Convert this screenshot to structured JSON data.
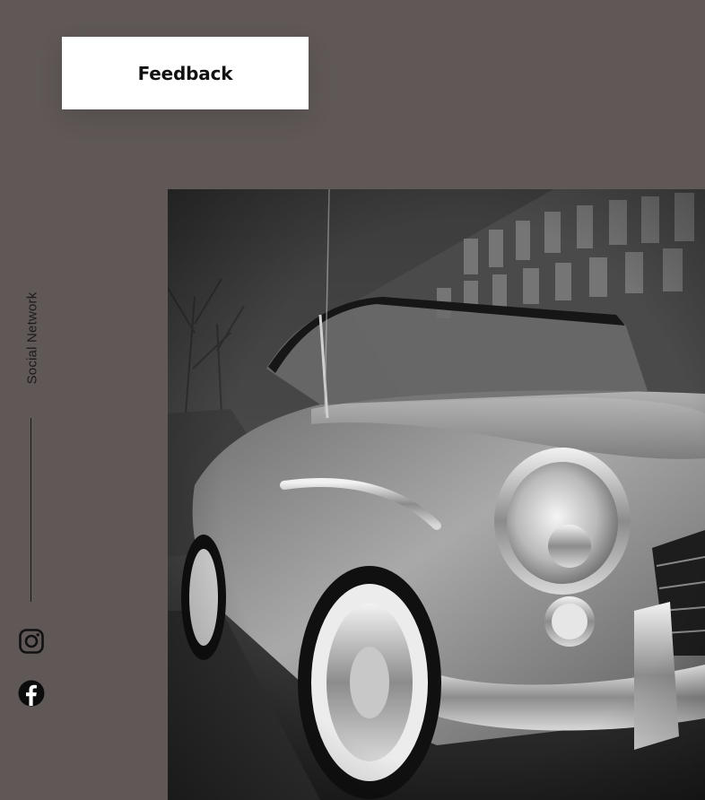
{
  "feedback": {
    "label": "Feedback"
  },
  "social": {
    "label": "Social Network",
    "icons": [
      "instagram-icon",
      "facebook-icon"
    ]
  },
  "colors": {
    "background": "#5f5857",
    "button_background": "#ffffff",
    "text_dark": "#111111"
  },
  "hero_image": {
    "subject": "black and white vintage convertible car"
  }
}
